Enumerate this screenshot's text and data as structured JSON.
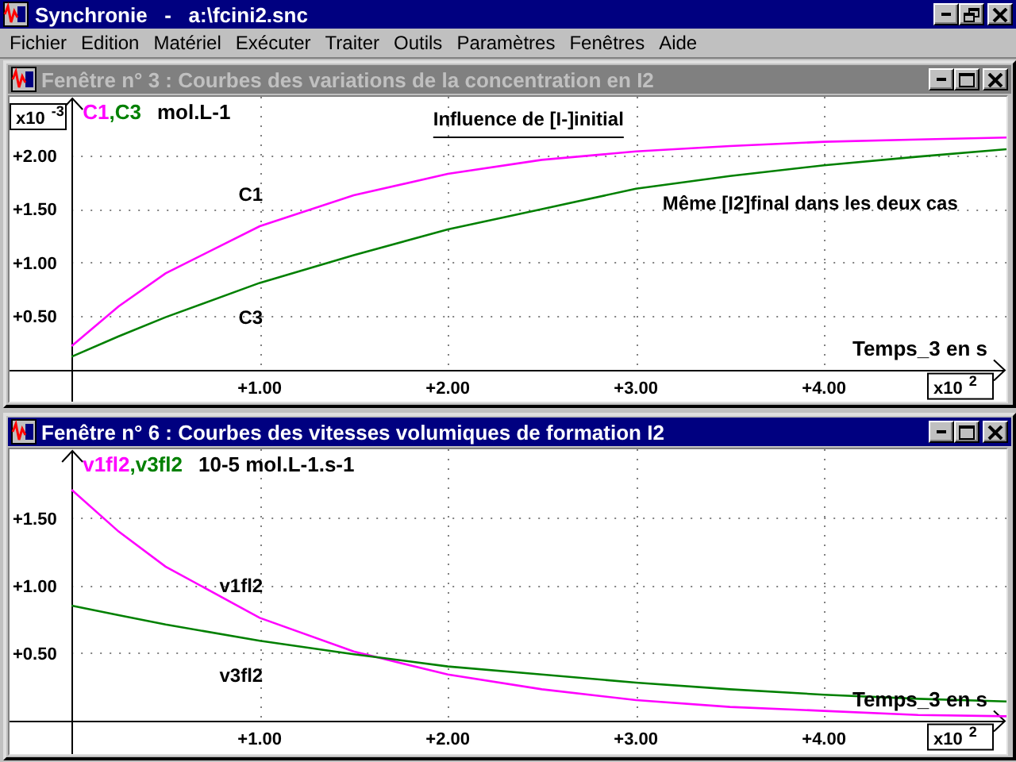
{
  "app": {
    "title": "Synchronie   -   a:\\fcini2.snc",
    "maximized": true
  },
  "menu": [
    {
      "label": "Fichier"
    },
    {
      "label": "Edition"
    },
    {
      "label": "Matériel"
    },
    {
      "label": "Exécuter"
    },
    {
      "label": "Traiter"
    },
    {
      "label": "Outils"
    },
    {
      "label": "Paramètres"
    },
    {
      "label": "Fenêtres"
    },
    {
      "label": "Aide"
    }
  ],
  "windows": [
    {
      "title": "Fenêtre n° 3 : Courbes des variations de la concentration en I2",
      "active": false,
      "legend": [
        "C1",
        ",C3"
      ],
      "y_scale": {
        "base": "x10",
        "exponent": "-3"
      },
      "x_scale": {
        "base": "x10",
        "exponent": "2"
      },
      "chart_data": {
        "type": "line",
        "xlabel": "Temps_3 en s",
        "ylabel": "mol.L-1",
        "grid": true,
        "x": [
          0,
          0.25,
          0.5,
          1,
          1.5,
          2,
          2.5,
          3,
          3.5,
          4,
          4.5,
          4.97
        ],
        "series": [
          {
            "name": "C1",
            "color": "#ff00ff",
            "values": [
              0.22,
              0.59,
              0.9,
              1.34,
              1.63,
              1.83,
              1.96,
              2.04,
              2.09,
              2.13,
              2.15,
              2.17
            ]
          },
          {
            "name": "C3",
            "color": "#008000",
            "values": [
              0.12,
              0.31,
              0.49,
              0.81,
              1.07,
              1.31,
              1.5,
              1.69,
              1.81,
              1.91,
              1.99,
              2.06
            ]
          }
        ],
        "xlim": [
          -0.33,
          4.97
        ],
        "ylim": [
          -0.3,
          2.55
        ],
        "xticks": [
          {
            "value": 1,
            "label": "+1.00"
          },
          {
            "value": 2,
            "label": "+2.00"
          },
          {
            "value": 3,
            "label": "+3.00"
          },
          {
            "value": 4,
            "label": "+4.00"
          }
        ],
        "yticks": [
          {
            "value": 0.5,
            "label": "+0.50"
          },
          {
            "value": 1,
            "label": "+1.00"
          },
          {
            "value": 1.5,
            "label": "+1.50"
          },
          {
            "value": 2,
            "label": "+2.00"
          }
        ],
        "annotations": [
          "Influence de [I-]initial",
          "Même [I2]final dans les deux cas"
        ]
      }
    },
    {
      "title": "Fenêtre n° 6 : Courbes des vitesses volumiques de formation I2",
      "active": true,
      "legend": [
        "v1fl2",
        ",v3fl2"
      ],
      "x_scale": {
        "base": "x10",
        "exponent": "2"
      },
      "chart_data": {
        "type": "line",
        "xlabel": "Temps_3 en s",
        "ylabel": "10-5 mol.L-1.s-1",
        "grid": true,
        "x": [
          0,
          0.25,
          0.5,
          1,
          1.5,
          2,
          2.5,
          3,
          3.5,
          4,
          4.5,
          4.97
        ],
        "series": [
          {
            "name": "v1fl2",
            "color": "#ff00ff",
            "values": [
              1.71,
              1.4,
              1.14,
              0.76,
              0.51,
              0.34,
              0.23,
              0.15,
              0.1,
              0.07,
              0.04,
              0.03
            ]
          },
          {
            "name": "v3fl2",
            "color": "#008000",
            "values": [
              0.85,
              0.78,
              0.71,
              0.59,
              0.49,
              0.4,
              0.34,
              0.28,
              0.23,
              0.19,
              0.16,
              0.14
            ]
          }
        ],
        "xlim": [
          -0.33,
          4.97
        ],
        "ylim": [
          -0.25,
          2.01
        ],
        "xticks": [
          {
            "value": 1,
            "label": "+1.00"
          },
          {
            "value": 2,
            "label": "+2.00"
          },
          {
            "value": 3,
            "label": "+3.00"
          },
          {
            "value": 4,
            "label": "+4.00"
          }
        ],
        "yticks": [
          {
            "value": 0.5,
            "label": "+0.50"
          },
          {
            "value": 1,
            "label": "+1.00"
          },
          {
            "value": 1.5,
            "label": "+1.50"
          }
        ]
      }
    }
  ]
}
